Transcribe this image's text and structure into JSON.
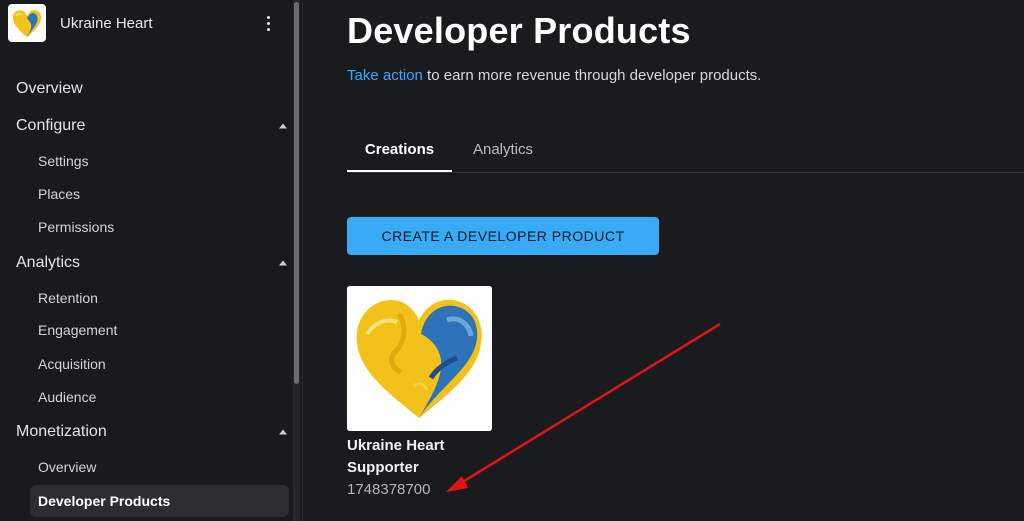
{
  "experience": {
    "name": "Ukraine Heart",
    "thumbnail_icon": "heart-thumbnail-icon",
    "menu_icon": "kebab-menu-icon"
  },
  "sidebar": {
    "overview": "Overview",
    "configure": "Configure",
    "settings": "Settings",
    "places": "Places",
    "permissions": "Permissions",
    "analytics": "Analytics",
    "retention": "Retention",
    "engagement": "Engagement",
    "acquisition": "Acquisition",
    "audience": "Audience",
    "monetization": "Monetization",
    "monetization_overview": "Overview",
    "developer_products": "Developer Products"
  },
  "main": {
    "title": "Developer Products",
    "subtitle_link": "Take action",
    "subtitle_rest": " to earn more revenue through developer products.",
    "tabs": [
      "Creations",
      "Analytics"
    ],
    "active_tab": "Creations",
    "create_button": "CREATE A DEVELOPER PRODUCT"
  },
  "product": {
    "name": "Ukraine Heart Supporter",
    "id": "1748378700",
    "image_icon": "yellow-blue-heart-icon"
  },
  "annotation": {
    "arrow_color": "#e01414"
  },
  "colors": {
    "background": "#1a1b1f",
    "accent_button": "#38aaf6",
    "link": "#3ba6ff",
    "heart_yellow": "#f2c21b",
    "heart_blue": "#2e72b8"
  }
}
